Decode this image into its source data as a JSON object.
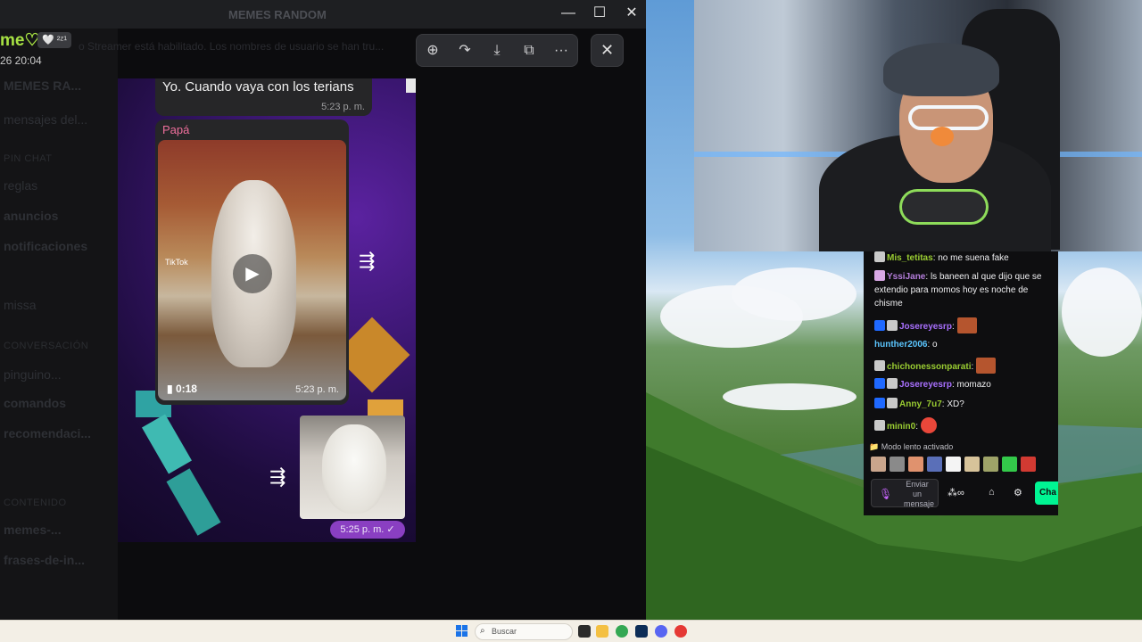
{
  "window": {
    "title": "MEMES RANDOM",
    "controls": [
      "—",
      "☐",
      "✕"
    ]
  },
  "discord_bg": {
    "username": "me♡",
    "badge": "🤍 ²ᶻ¹",
    "timestamp": "26 20:04",
    "banner": "o Streamer está habilitado. Los nombres de usuario se han tru...",
    "server_name": "MEMES RA...",
    "sidebar_items": [
      {
        "label": "mensajes del..."
      },
      {
        "label": "pinguino..."
      },
      {
        "label": "reglas"
      },
      {
        "label": "anuncios"
      },
      {
        "label": "notificaciones"
      },
      {
        "label": "missa"
      },
      {
        "label": "comandos"
      },
      {
        "label": "recomendaci..."
      },
      {
        "label": "memes-..."
      },
      {
        "label": "frases-de-in..."
      }
    ],
    "categories": [
      "PIN CHAT",
      "CONVERSACIÓN",
      "CONTENIDO"
    ]
  },
  "viewer": {
    "toolbar_icons": [
      "zoom-in-icon",
      "forward-icon",
      "download-icon",
      "open-external-icon",
      "more-icon"
    ],
    "close_label": "✕"
  },
  "chat_image": {
    "message1_text": "Yo. Cuando vaya con los terians",
    "message1_time": "5:23 p. m.",
    "sender": "Papá",
    "video_duration": "0:18",
    "video_time": "5:23 p. m.",
    "video_watermark": "TikTok",
    "sent_time": "5:25 p. m. ✓"
  },
  "twitch_chat": {
    "messages": [
      {
        "user": "Mis_tetitas",
        "color": "#9acd32",
        "text": "no me suena fake",
        "badges": [
          "sub"
        ]
      },
      {
        "user": "YssiJane",
        "color": "#b57edc",
        "text": "ls baneen al que dijo que se extendio para momos hoy es noche de chisme",
        "badges": [
          "sub"
        ]
      },
      {
        "user": "Josereyesrp",
        "color": "#a970ff",
        "text": "",
        "badges": [
          "prime",
          "sub"
        ],
        "emote": true
      },
      {
        "user": "hunther2006",
        "color": "#5bc6ff",
        "text": "o",
        "badges": []
      },
      {
        "user": "chichonessonparati",
        "color": "#9acd32",
        "text": "",
        "badges": [
          "sub"
        ],
        "emote": true
      },
      {
        "user": "Josereyesrp",
        "color": "#a970ff",
        "text": "momazo",
        "badges": [
          "prime",
          "sub"
        ]
      },
      {
        "user": "Anny_7u7",
        "color": "#9acd32",
        "text": "XD?",
        "badges": [
          "prime",
          "sub"
        ]
      },
      {
        "user": "minin0",
        "color": "#9acd32",
        "text": "",
        "badges": [
          "sub"
        ],
        "emoji": true
      }
    ],
    "slow_mode": "Modo lento activado",
    "input_placeholder": "Enviar un mensaje",
    "chat_button": "Cha"
  },
  "taskbar": {
    "search_placeholder": "Buscar"
  }
}
